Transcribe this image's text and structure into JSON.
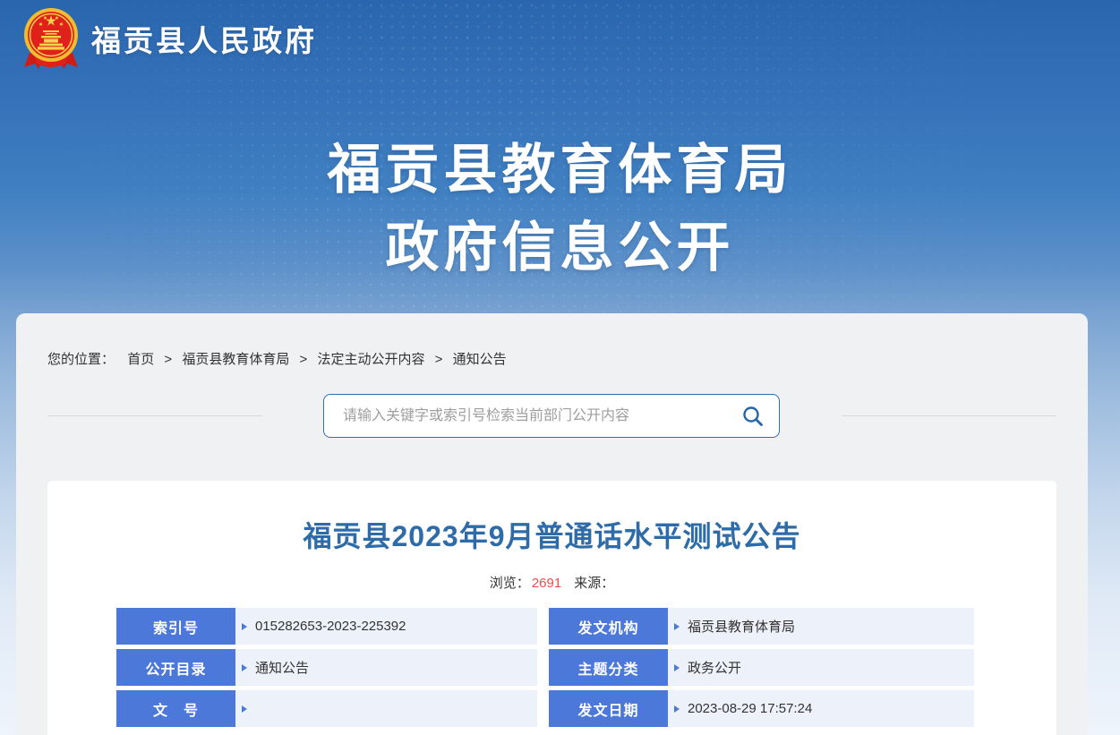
{
  "header": {
    "site_title": "福贡县人民政府",
    "emblem_icon": "china-national-emblem-icon"
  },
  "banner": {
    "line1": "福贡县教育体育局",
    "line2": "政府信息公开"
  },
  "breadcrumb": {
    "label": "您的位置：",
    "separator": ">",
    "items": [
      "首页",
      "福贡县教育体育局",
      "法定主动公开内容",
      "通知公告"
    ]
  },
  "search": {
    "placeholder": "请输入关键字或索引号检索当前部门公开内容",
    "icon": "search-icon"
  },
  "article": {
    "title": "福贡县2023年9月普通话水平测试公告",
    "views_label": "浏览：",
    "views_count": "2691",
    "source_label": "来源：",
    "info_table": {
      "rows": [
        [
          {
            "label": "索引号",
            "value": "015282653-2023-225392"
          },
          {
            "label": "发文机构",
            "value": "福贡县教育体育局"
          }
        ],
        [
          {
            "label": "公开目录",
            "value": "通知公告"
          },
          {
            "label": "主题分类",
            "value": "政务公开"
          }
        ],
        [
          {
            "label": "文　号",
            "value": ""
          },
          {
            "label": "发文日期",
            "value": "2023-08-29 17:57:24"
          }
        ]
      ]
    }
  },
  "colors": {
    "header_blue": "#2a66ad",
    "search_border_blue": "#2e6cb0",
    "title_blue": "#2e6ba9",
    "table_label_blue": "#4c78d9",
    "table_value_bg": "#edf1f9",
    "views_red": "#ee4c4c",
    "shell_grey": "#f0f1f2"
  }
}
